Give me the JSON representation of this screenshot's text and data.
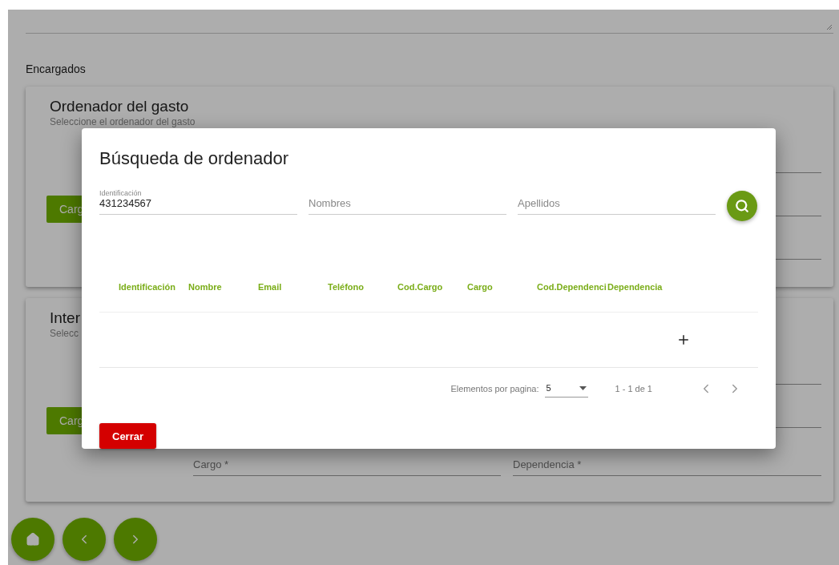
{
  "background": {
    "section_label": "Encargados",
    "cards": [
      {
        "title": "Ordenador del gasto",
        "subtitle": "Seleccione el ordenador del gasto",
        "button": "Carg"
      },
      {
        "title": "Inter",
        "subtitle": "Selecc",
        "button": "Carg",
        "fields": [
          {
            "label": "Cargo *"
          },
          {
            "label": "Dependencia *"
          }
        ]
      }
    ],
    "nav_buttons": [
      {
        "kind": "home"
      },
      {
        "kind": "prev"
      },
      {
        "kind": "next"
      }
    ]
  },
  "dialog": {
    "title": "Búsqueda de ordenador",
    "fields": [
      {
        "label": "Identificación",
        "value": "431234567"
      },
      {
        "placeholder": "Nombres"
      },
      {
        "placeholder": "Apellidos"
      }
    ],
    "table": {
      "columns": [
        "Identificación",
        "Nombre",
        "Email",
        "Teléfono",
        "Cod.Cargo",
        "Cargo",
        "Cod.Dependenci",
        "Dependencia"
      ]
    },
    "paginator": {
      "label": "Elementos por pagina:",
      "page_size": "5",
      "range": "1 - 1 de 1"
    },
    "close_button": "Cerrar"
  }
}
